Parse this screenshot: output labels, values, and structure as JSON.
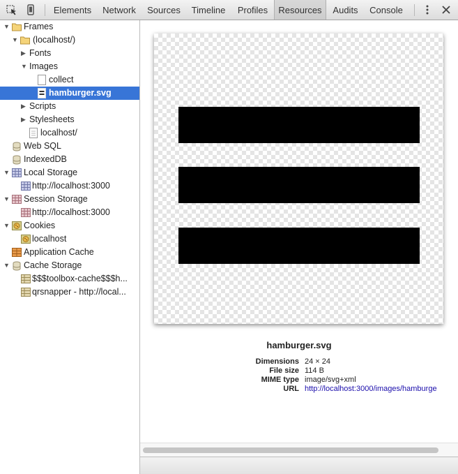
{
  "toolbar": {
    "tabs": [
      {
        "label": "Elements"
      },
      {
        "label": "Network"
      },
      {
        "label": "Sources"
      },
      {
        "label": "Timeline"
      },
      {
        "label": "Profiles"
      },
      {
        "label": "Resources",
        "active": true
      },
      {
        "label": "Audits"
      },
      {
        "label": "Console"
      }
    ],
    "icons": {
      "inspect": "inspect-element-icon",
      "device": "device-mode-icon",
      "more": "kebab-menu-icon",
      "close": "close-icon"
    }
  },
  "sidebar": {
    "items": [
      {
        "label": "Frames",
        "icon": "folder-icon",
        "expanded": true
      },
      {
        "label": "(localhost/)",
        "icon": "folder-icon",
        "expanded": true
      },
      {
        "label": "Fonts",
        "expanded": false
      },
      {
        "label": "Images",
        "expanded": true
      },
      {
        "label": "collect",
        "icon": "document-icon"
      },
      {
        "label": "hamburger.svg",
        "icon": "image-file-icon",
        "selected": true
      },
      {
        "label": "Scripts",
        "expanded": false
      },
      {
        "label": "Stylesheets",
        "expanded": false
      },
      {
        "label": "localhost/",
        "icon": "document-icon"
      },
      {
        "label": "Web SQL",
        "icon": "database-icon"
      },
      {
        "label": "IndexedDB",
        "icon": "database-icon"
      },
      {
        "label": "Local Storage",
        "icon": "storage-grid-icon",
        "expanded": true
      },
      {
        "label": "http://localhost:3000",
        "icon": "storage-grid-icon"
      },
      {
        "label": "Session Storage",
        "icon": "storage-grid-icon",
        "expanded": true
      },
      {
        "label": "http://localhost:3000",
        "icon": "storage-grid-icon"
      },
      {
        "label": "Cookies",
        "icon": "cookie-icon",
        "expanded": true
      },
      {
        "label": "localhost",
        "icon": "cookie-icon"
      },
      {
        "label": "Application Cache",
        "icon": "app-cache-icon"
      },
      {
        "label": "Cache Storage",
        "icon": "database-icon",
        "expanded": true
      },
      {
        "label": "$$$toolbox-cache$$$h...",
        "icon": "cache-table-icon"
      },
      {
        "label": "qrsnapper - http://local...",
        "icon": "cache-table-icon"
      }
    ]
  },
  "preview": {
    "filename": "hamburger.svg",
    "metadata": [
      {
        "key": "Dimensions",
        "value": "24 × 24"
      },
      {
        "key": "File size",
        "value": "114 B"
      },
      {
        "key": "MIME type",
        "value": "image/svg+xml"
      },
      {
        "key": "URL",
        "value": "http://localhost:3000/images/hamburge"
      }
    ]
  },
  "colors": {
    "selection": "#3875d7",
    "link": "#1a0dab"
  }
}
